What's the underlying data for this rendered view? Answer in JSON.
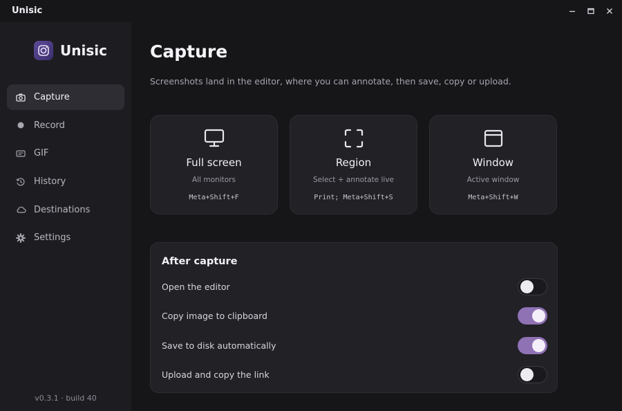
{
  "app": {
    "title": "Unisic",
    "brand": "Unisic",
    "version": "v0.3.1 · build 40"
  },
  "window_controls": {
    "minimize": "minimize-icon",
    "maximize": "maximize-icon",
    "close": "close-icon"
  },
  "sidebar": {
    "items": [
      {
        "label": "Capture",
        "icon": "camera-icon",
        "active": true
      },
      {
        "label": "Record",
        "icon": "record-dot-icon",
        "active": false
      },
      {
        "label": "GIF",
        "icon": "gif-icon",
        "active": false
      },
      {
        "label": "History",
        "icon": "history-icon",
        "active": false
      },
      {
        "label": "Destinations",
        "icon": "cloud-icon",
        "active": false
      },
      {
        "label": "Settings",
        "icon": "gear-icon",
        "active": false
      }
    ]
  },
  "main": {
    "title": "Capture",
    "subtitle": "Screenshots land in the editor, where you can annotate, then save, copy or upload.",
    "cards": [
      {
        "title": "Full screen",
        "desc": "All monitors",
        "shortcut": "Meta+Shift+F",
        "icon": "monitor-icon"
      },
      {
        "title": "Region",
        "desc": "Select + annotate live",
        "shortcut": "Print; Meta+Shift+S",
        "icon": "region-select-icon"
      },
      {
        "title": "Window",
        "desc": "Active window",
        "shortcut": "Meta+Shift+W",
        "icon": "window-icon"
      }
    ],
    "after_capture": {
      "title": "After capture",
      "options": [
        {
          "label": "Open the editor",
          "enabled": false
        },
        {
          "label": "Copy image to clipboard",
          "enabled": true
        },
        {
          "label": "Save to disk automatically",
          "enabled": true
        },
        {
          "label": "Upload and copy the link",
          "enabled": false
        }
      ]
    }
  },
  "colors": {
    "accent": "#8f72b4",
    "background": "#161619",
    "sidebar": "#1d1d21",
    "card": "#212126"
  }
}
